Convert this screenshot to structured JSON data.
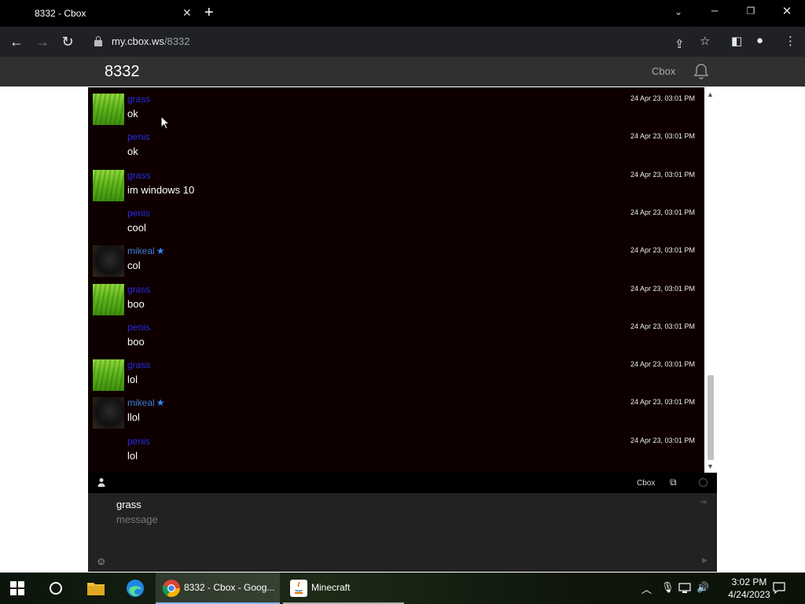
{
  "browser": {
    "tab_title": "8332 - Cbox",
    "url_host": "my.cbox.ws",
    "url_path": "/8332"
  },
  "page": {
    "box_title": "8332",
    "cbox_link": "Cbox"
  },
  "messages": [
    {
      "user": "grass",
      "text": "ok",
      "time": "24 Apr 23, 03:01 PM",
      "avatar": "grass",
      "starred": false
    },
    {
      "user": "penis",
      "text": "ok",
      "time": "24 Apr 23, 03:01 PM",
      "avatar": "none",
      "starred": false
    },
    {
      "user": "grass",
      "text": "im windows 10",
      "time": "24 Apr 23, 03:01 PM",
      "avatar": "grass",
      "starred": false
    },
    {
      "user": "penis",
      "text": "cool",
      "time": "24 Apr 23, 03:01 PM",
      "avatar": "none",
      "starred": false
    },
    {
      "user": "mikeal",
      "text": "col",
      "time": "24 Apr 23, 03:01 PM",
      "avatar": "mikeal",
      "starred": true
    },
    {
      "user": "grass",
      "text": "boo",
      "time": "24 Apr 23, 03:01 PM",
      "avatar": "grass",
      "starred": false
    },
    {
      "user": "penis",
      "text": "boo",
      "time": "24 Apr 23, 03:01 PM",
      "avatar": "none",
      "starred": false
    },
    {
      "user": "grass",
      "text": "lol",
      "time": "24 Apr 23, 03:01 PM",
      "avatar": "grass",
      "starred": false
    },
    {
      "user": "mikeal",
      "text": "llol",
      "time": "24 Apr 23, 03:01 PM",
      "avatar": "mikeal",
      "starred": true
    },
    {
      "user": "penis",
      "text": "lol",
      "time": "24 Apr 23, 03:01 PM",
      "avatar": "none",
      "starred": false
    }
  ],
  "footer": {
    "cbox_label": "Cbox"
  },
  "compose": {
    "name_value": "grass",
    "message_placeholder": "message"
  },
  "taskbar": {
    "chrome_label": "8332 - Cbox - Goog...",
    "minecraft_label": "Minecraft",
    "time": "3:02 PM",
    "date": "4/24/2023"
  },
  "colors": {
    "chat_bg": "#0e0000",
    "username": "#2a2ae0",
    "star": "#2e8bff"
  }
}
